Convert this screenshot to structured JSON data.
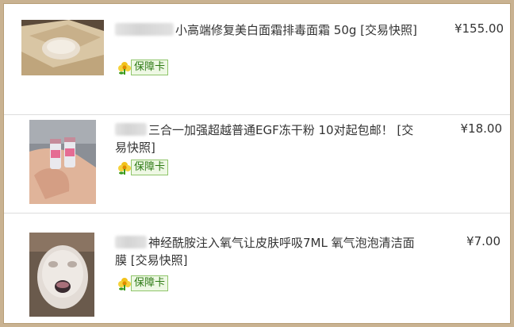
{
  "items": [
    {
      "title": "小高端修复美白面霜排毒面霜 50g [交易快照]",
      "badge": "保障卡",
      "price": "¥155.00",
      "image": "cream-jar-in-box"
    },
    {
      "title": "三合一加强超越普通EGF冻干粉 10对起包邮！ [交易快照]",
      "badge": "保障卡",
      "price": "¥18.00",
      "image": "vials-in-hand"
    },
    {
      "title": "神经酰胺注入氧气让皮肤呼吸7ML 氧气泡泡清洁面膜 [交易快照]",
      "badge": "保障卡",
      "price": "¥7.00",
      "image": "face-with-foam-mask"
    }
  ],
  "colors": {
    "border": "#c9b291",
    "text": "#333333",
    "badge_green": "#2d7a14"
  }
}
